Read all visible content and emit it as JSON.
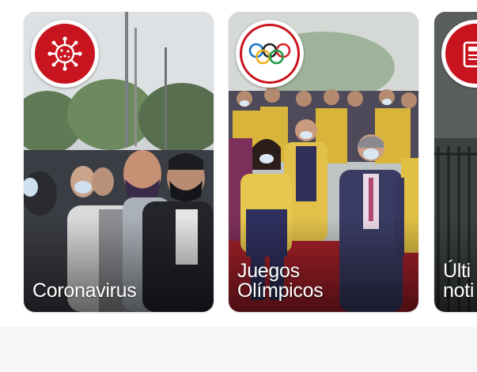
{
  "stories": [
    {
      "id": "coronavirus",
      "title_lines": [
        "Coronavirus"
      ],
      "icon": "virus-icon",
      "badge_color": "#c8141e"
    },
    {
      "id": "juegos-olimpicos",
      "title_lines": [
        "Juegos",
        "Olímpicos"
      ],
      "icon": "olympic-rings-icon",
      "badge_color": "#ffffff"
    },
    {
      "id": "ultimas-noticias",
      "title_lines": [
        "Últi",
        "noti"
      ],
      "icon": "newspaper-icon",
      "badge_color": "#c8141e"
    }
  ],
  "colors": {
    "accent": "#c8141e",
    "footer_background": "#f6f6f7"
  }
}
